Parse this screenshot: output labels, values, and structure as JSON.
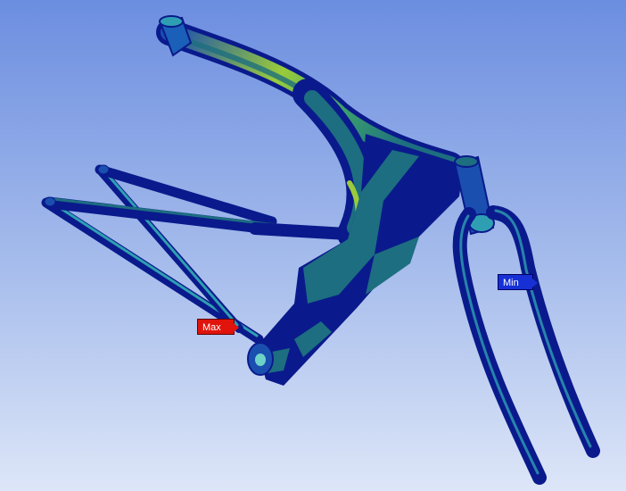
{
  "colors": {
    "background_top": "#6c8ee0",
    "background_bottom": "#dde6f8",
    "result_low": "#0a1a8c",
    "result_mid": "#1d6e80",
    "result_high": "#86c23a",
    "max_probe": "#e0140c",
    "min_probe": "#1630d6"
  },
  "probes": {
    "max": {
      "label": "Max"
    },
    "min": {
      "label": "Min"
    }
  }
}
